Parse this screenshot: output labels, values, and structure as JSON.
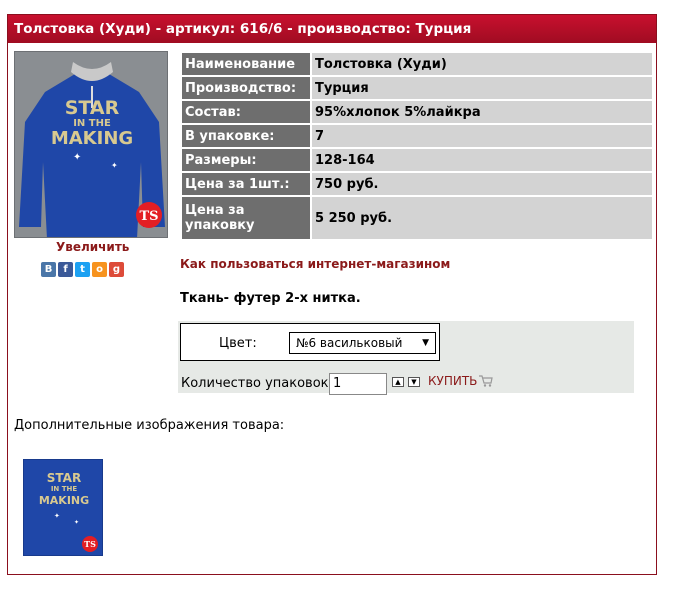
{
  "header": {
    "title": "Толстовка (Худи) - артикул: 616/6 - производство: Турция"
  },
  "left": {
    "enlarge_label": "Увеличить",
    "social_icons": [
      "vkontakte-icon",
      "facebook-icon",
      "twitter-icon",
      "odnoklassniki-icon",
      "google-plus-icon"
    ],
    "print_text_1": "STAR",
    "print_text_2": "IN THE",
    "print_text_3": "MAKING"
  },
  "props": [
    {
      "key": "Наименование",
      "value": "Толстовка (Худи)"
    },
    {
      "key": "Производство:",
      "value": "Турция"
    },
    {
      "key": "Состав:",
      "value": "95%хлопок 5%лайкра"
    },
    {
      "key": "В упаковке:",
      "value": "7"
    },
    {
      "key": "Размеры:",
      "value": "128-164"
    },
    {
      "key": "Цена за 1шт.:",
      "value": "750 руб."
    },
    {
      "key": "Цена за упаковку",
      "value": "5 250 руб."
    }
  ],
  "howto_link": "Как пользоваться интернет-магазином",
  "fabric_note": "Ткань- футер 2-х нитка.",
  "order": {
    "color_label": "Цвет:",
    "color_selected": "№6 васильковый",
    "qty_label": "Количество упаковок:",
    "qty_value": "1",
    "buy_label": "КУПИТЬ"
  },
  "extra_images_label": "Дополнительные изображения товара:",
  "colors": {
    "header_red": "#c8102e",
    "link": "#8b1a1a",
    "hoodie_blue": "#1f47a8"
  }
}
